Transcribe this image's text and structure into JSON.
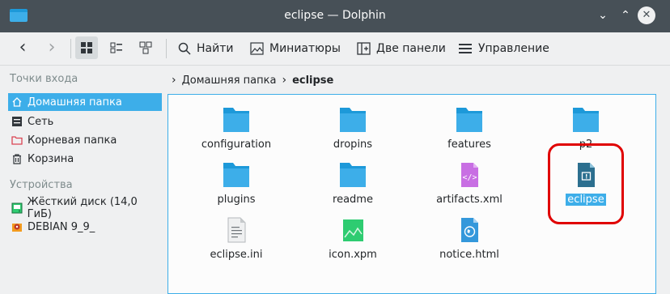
{
  "window": {
    "title": "eclipse — Dolphin"
  },
  "toolbar": {
    "find": "Найти",
    "preview": "Миниатюры",
    "split": "Две панели",
    "control": "Управление"
  },
  "sidebar": {
    "places_header": "Точки входа",
    "places": [
      {
        "label": "Домашняя папка",
        "icon": "home-icon"
      },
      {
        "label": "Сеть",
        "icon": "network-icon"
      },
      {
        "label": "Корневая папка",
        "icon": "root-folder-icon"
      },
      {
        "label": "Корзина",
        "icon": "trash-icon"
      }
    ],
    "devices_header": "Устройства",
    "devices": [
      {
        "label": "Жёсткий диск (14,0 ГиБ)",
        "icon": "hard-disk-icon"
      },
      {
        "label": "DEBIAN 9_9_",
        "icon": "optical-disc-icon"
      }
    ]
  },
  "breadcrumb": {
    "home": "Домашняя папка",
    "current": "eclipse"
  },
  "files": [
    {
      "name": "configuration",
      "type": "folder"
    },
    {
      "name": "dropins",
      "type": "folder"
    },
    {
      "name": "features",
      "type": "folder"
    },
    {
      "name": "p2",
      "type": "folder"
    },
    {
      "name": "plugins",
      "type": "folder"
    },
    {
      "name": "readme",
      "type": "folder"
    },
    {
      "name": "artifacts.xml",
      "type": "xml"
    },
    {
      "name": "eclipse",
      "type": "executable"
    },
    {
      "name": "eclipse.ini",
      "type": "text"
    },
    {
      "name": "icon.xpm",
      "type": "image"
    },
    {
      "name": "notice.html",
      "type": "html"
    }
  ],
  "colors": {
    "accent": "#3daee9",
    "titlebar": "#475057",
    "highlight_ring": "#e00000"
  }
}
